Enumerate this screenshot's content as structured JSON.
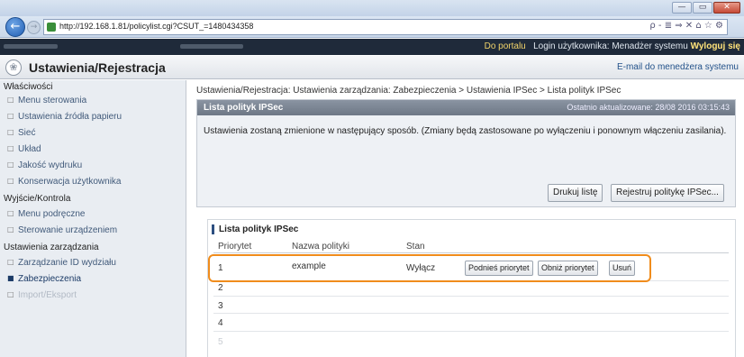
{
  "browser": {
    "url": "http://192.168.1.81/policylist.cgi?CSUT_=1480434358",
    "tools": "ρ - ≣ ⇒ ✕   ⌂ ☆ ⚙",
    "win_min": "—",
    "win_max": "▭",
    "win_close": "✕",
    "back_glyph": "←",
    "forward_glyph": "→"
  },
  "header": {
    "portal_link": "Do portalu",
    "login_label": "Login użytkownika: Menadżer systemu",
    "logout_link": "Wyloguj się"
  },
  "page": {
    "title": "Ustawienia/Rejestracja",
    "mail_link": "E-mail do menedżera systemu",
    "icon_glyph": "❀"
  },
  "sidebar": {
    "groups": [
      {
        "label": "Właściwości",
        "items": [
          "Menu sterowania",
          "Ustawienia źródła papieru",
          "Sieć",
          "Układ",
          "Jakość wydruku",
          "Konserwacja użytkownika"
        ]
      },
      {
        "label": "Wyjście/Kontrola",
        "items": [
          "Menu podręczne",
          "Sterowanie urządzeniem"
        ]
      },
      {
        "label": "Ustawienia zarządzania",
        "items": [
          "Zarządzanie ID wydziału",
          "Zabezpieczenia",
          "Import/Eksport"
        ]
      }
    ]
  },
  "breadcrumb": "Ustawienia/Rejestracja: Ustawienia zarządzania: Zabezpieczenia > Ustawienia IPSec > Lista polityk IPSec",
  "panel": {
    "title": "Lista polityk IPSec",
    "updated": "Ostatnio aktualizowane: 28/08 2016 03:15:43",
    "message": "Ustawienia zostaną zmienione w następujący sposób. (Zmiany będą zastosowane po wyłączeniu i ponownym włączeniu zasilania).",
    "print_button": "Drukuj listę",
    "register_button": "Rejestruj politykę IPSec..."
  },
  "policy_list": {
    "title": "Lista polityk IPSec",
    "columns": [
      "Priorytet",
      "Nazwa polityki",
      "Stan"
    ],
    "rows": [
      {
        "priority": "1",
        "name": "example",
        "state": "Wyłącz"
      },
      {
        "priority": "2"
      },
      {
        "priority": "3"
      },
      {
        "priority": "4"
      },
      {
        "priority": "5"
      }
    ],
    "raise_button": "Podnieś priorytet",
    "lower_button": "Obniż priorytet",
    "delete_button": "Usuń"
  },
  "colors": {
    "highlight": "#f08c1c",
    "header_bg": "#1f2a3a",
    "header_link": "#f2d46a",
    "panel_head": "#7a8492"
  }
}
